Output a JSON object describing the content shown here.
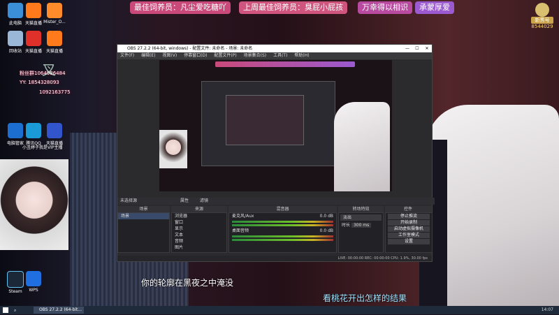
{
  "banner": {
    "items": [
      {
        "text": "最佳饲养员：凡尘爱吃糖吖",
        "color": "#c94a7a"
      },
      {
        "text": "上周最佳饲养员：臭屁小屁孩",
        "color": "#d0557e"
      },
      {
        "text": "万幸得以相识",
        "color": "#b84aa0"
      },
      {
        "text": "承蒙厚爱",
        "color": "#9b5ad0"
      }
    ],
    "level": "8544029",
    "level_label": "新秀号"
  },
  "desktop_icons": [
    "此电脑",
    "天猫直播",
    "Mister_O...",
    "回收站",
    "天猫直播",
    "天猫直播",
    "电脑管家",
    "腾讯QQ",
    "天猫直播",
    "Steam",
    "WPS"
  ],
  "overlay_text": {
    "line1": "粉丝群1064986484",
    "line2": "YY: 1854328093",
    "line3": "1092163775",
    "line4": "小丑婷子我是VIP主播",
    "word": "叉"
  },
  "obs": {
    "title": "OBS 27.2.2 (64-bit, windows) - 配置文件: 未命名 - 场景: 未命名",
    "menu": [
      "文件(F)",
      "编辑(E)",
      "视图(V)",
      "停靠窗口(D)",
      "配置文件(P)",
      "场景集合(S)",
      "工具(T)",
      "帮助(H)"
    ],
    "no_source": "未选择源",
    "buttons_top": [
      "属性",
      "滤镜"
    ],
    "docks": {
      "scenes": {
        "title": "场景",
        "items": [
          "场景"
        ]
      },
      "sources": {
        "title": "来源",
        "items": [
          "浏览器",
          "窗口",
          "显示",
          "文本",
          "音频",
          "图片"
        ]
      },
      "mixer": {
        "title": "混音器",
        "tracks": [
          {
            "name": "麦克风/Aux",
            "level": "0.0 dB"
          },
          {
            "name": "桌面音频",
            "level": "0.0 dB"
          }
        ]
      },
      "transitions": {
        "title": "转场特效",
        "type": "淡出",
        "duration_label": "时长",
        "duration": "300 ms"
      },
      "controls": {
        "title": "控件",
        "items": [
          "停止推流",
          "开始录制",
          "启动虚拟摄像机",
          "工作室模式",
          "设置",
          "退出"
        ]
      }
    },
    "status": "LIVE: 00:00:00   REC: 00:00:00   CPU: 1.9%, 30.00 fps"
  },
  "subtitles": {
    "line1": "你的轮廓在黑夜之中淹没",
    "line2": "看桃花开出怎样的结果"
  },
  "taskbar": {
    "task": "OBS 27.2.2 (64-bit...",
    "clock": "14:07"
  }
}
